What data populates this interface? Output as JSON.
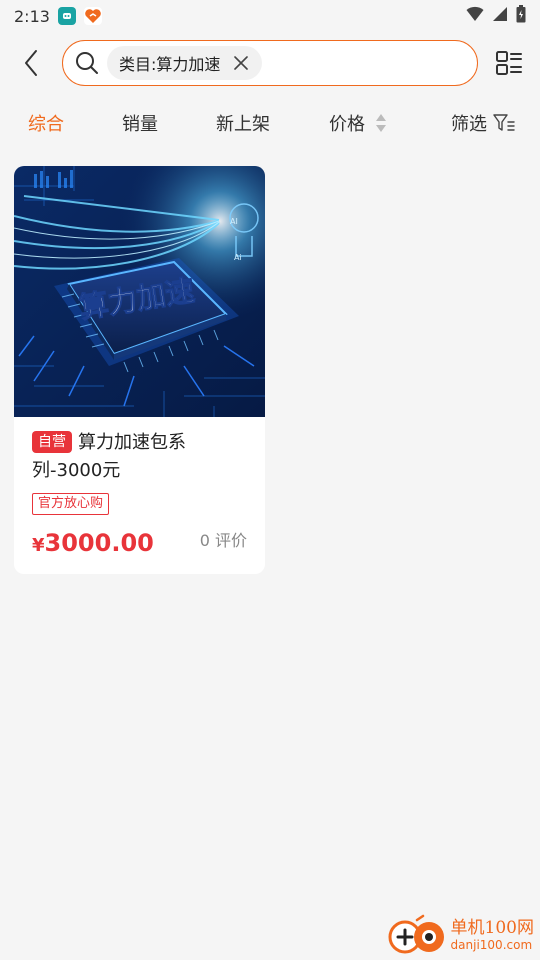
{
  "status_bar": {
    "time": "2:13"
  },
  "search": {
    "chip_label": "类目:算力加速"
  },
  "sort_tabs": [
    {
      "label": "综合",
      "active": true
    },
    {
      "label": "销量"
    },
    {
      "label": "新上架"
    },
    {
      "label": "价格"
    },
    {
      "label": "筛选"
    }
  ],
  "product": {
    "image_text": "算力加速",
    "self_tag": "自营",
    "title": "算力加速包系列-3000元",
    "title_line1": "算力加速包系",
    "title_line2": "列-3000元",
    "official_tag": "官方放心购",
    "price_symbol": "¥",
    "price_value": "3000.00",
    "reviews": "0 评价"
  },
  "watermark": {
    "main": "单机100网",
    "sub": "danji100.com"
  },
  "colors": {
    "accent": "#f06a1e",
    "price": "#e8343a",
    "background": "#f5f5f5"
  }
}
